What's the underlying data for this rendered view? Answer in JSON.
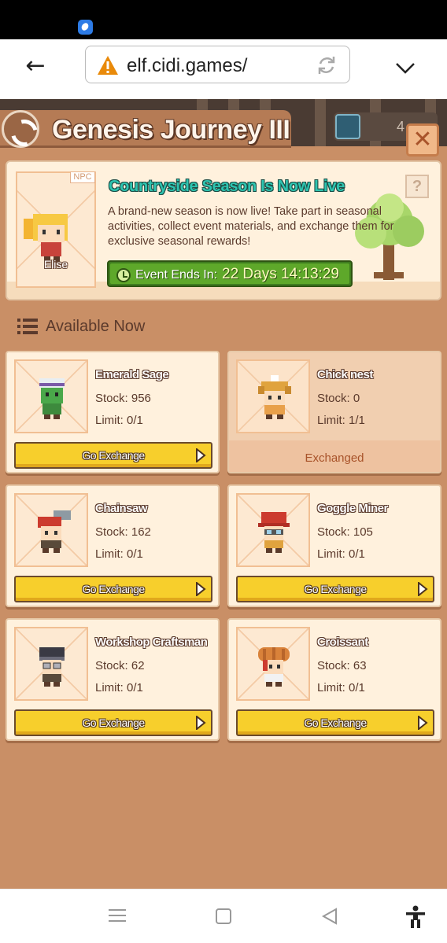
{
  "browser": {
    "url": "elf.cidi.games/"
  },
  "header": {
    "title": "Genesis Journey III",
    "currency_value": "4"
  },
  "banner": {
    "npc_tag": "NPC",
    "npc_name": "Elise",
    "title": "Countryside Season Is Now Live",
    "description": "A brand-new season is now live! Take part in seasonal activities, collect event materials, and exchange them for exclusive seasonal rewards!",
    "help_label": "?",
    "timer_label": "Event Ends In:",
    "timer_value": "22 Days  14:13:29"
  },
  "section": {
    "title": "Available Now"
  },
  "items": [
    {
      "name": "Emerald Sage",
      "stock": "Stock: 956",
      "limit": "Limit: 0/1",
      "action": "Go Exchange"
    },
    {
      "name": "Chick nest",
      "stock": "Stock: 0",
      "limit": "Limit: 1/1",
      "action": "Exchanged"
    },
    {
      "name": "Chainsaw",
      "stock": "Stock: 162",
      "limit": "Limit: 0/1",
      "action": "Go Exchange"
    },
    {
      "name": "Goggle Miner",
      "stock": "Stock: 105",
      "limit": "Limit: 0/1",
      "action": "Go Exchange"
    },
    {
      "name": "Workshop Craftsman",
      "stock": "Stock: 62",
      "limit": "Limit: 0/1",
      "action": "Go Exchange"
    },
    {
      "name": "Croissant",
      "stock": "Stock: 63",
      "limit": "Limit: 0/1",
      "action": "Go Exchange"
    }
  ],
  "icons": {
    "status": "app-notification-icon",
    "back": "back-arrow-icon",
    "security": "warning-icon",
    "reload": "reload-icon",
    "menu": "chevron-down-icon",
    "logo": "genesis-logo-icon",
    "close": "close-icon",
    "help": "help-icon",
    "clock": "clock-icon",
    "list": "list-icon",
    "play": "play-icon",
    "nav_menu": "recent-apps-icon",
    "nav_home": "home-icon",
    "nav_back": "nav-back-icon",
    "accessibility": "accessibility-icon"
  },
  "colors": {
    "panel_bg": "#c98f66",
    "card_bg": "#fff1dd",
    "button_yellow": "#f7cf2c",
    "title_teal": "#2ec4b0",
    "timer_green": "#5ea82a",
    "exchanged_text": "#a8532a"
  }
}
